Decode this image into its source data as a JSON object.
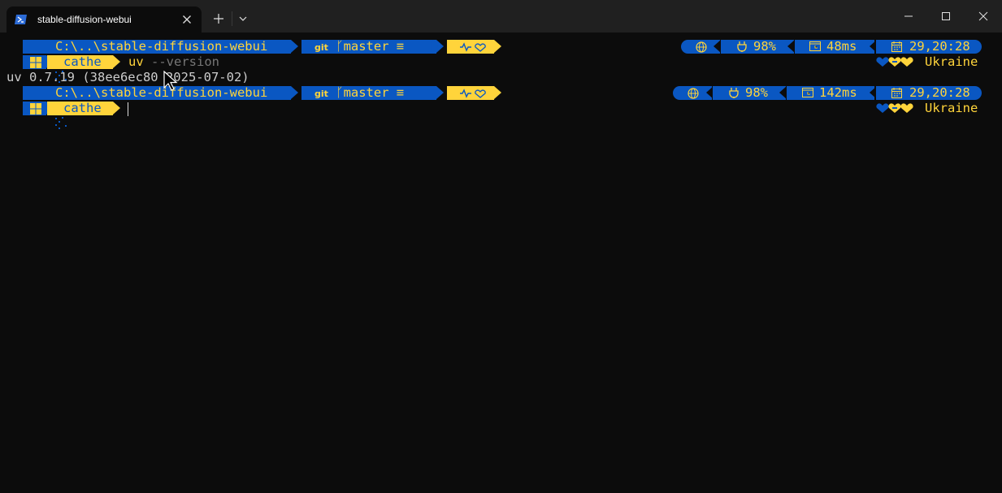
{
  "window": {
    "tab_title": "stable-diffusion-webui",
    "icons": [
      "powershell-icon",
      "close-icon",
      "plus-icon",
      "chevron-down-icon",
      "minimize-icon",
      "maximize-icon",
      "window-close-icon"
    ]
  },
  "colors": {
    "blue": "#0a57c2",
    "yellow": "#ffd43b",
    "background": "#0c0c0c"
  },
  "prompt1": {
    "path": "C:\\..\\stable-diffusion-webui",
    "git": "git",
    "branch": "master",
    "branch_status": "≡",
    "battery": "98%",
    "exec_time": "48ms",
    "datetime": "29,20:28",
    "user": "cathe",
    "command": "uv",
    "argument": "--version",
    "country": "Ukraine"
  },
  "output1": "uv 0.7.19 (38ee6ec80 2025-07-02)",
  "prompt2": {
    "path": "C:\\..\\stable-diffusion-webui",
    "git": "git",
    "branch": "master",
    "branch_status": "≡",
    "battery": "98%",
    "exec_time": "142ms",
    "datetime": "29,20:28",
    "user": "cathe",
    "country": "Ukraine"
  }
}
